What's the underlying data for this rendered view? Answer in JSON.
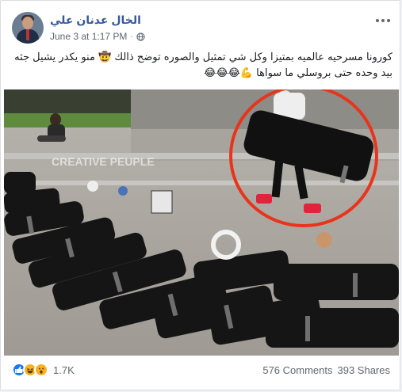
{
  "post": {
    "author": "الخال عدنان علي",
    "timestamp": "June 3 at 1:17 PM",
    "privacy_icon": "globe-icon",
    "text": "كورونا مسرحيه عالميه بمتيزا وكل شي تمثيل والصوره توضح ذالك 🤠 منو يكدر يشيل جثه بيد وحده حتى بروسلي ما سواها 💪😂😂😂",
    "image_watermark": "CREATIVE PEUPLE"
  },
  "footer": {
    "reactions": [
      "like",
      "haha",
      "wow"
    ],
    "reaction_count": "1.7K",
    "comments": "576 Comments",
    "shares": "393 Shares"
  },
  "colors": {
    "name": "#385898",
    "like": "#1877f2",
    "haha": "#f7b125",
    "highlight_circle": "#e8341c"
  }
}
